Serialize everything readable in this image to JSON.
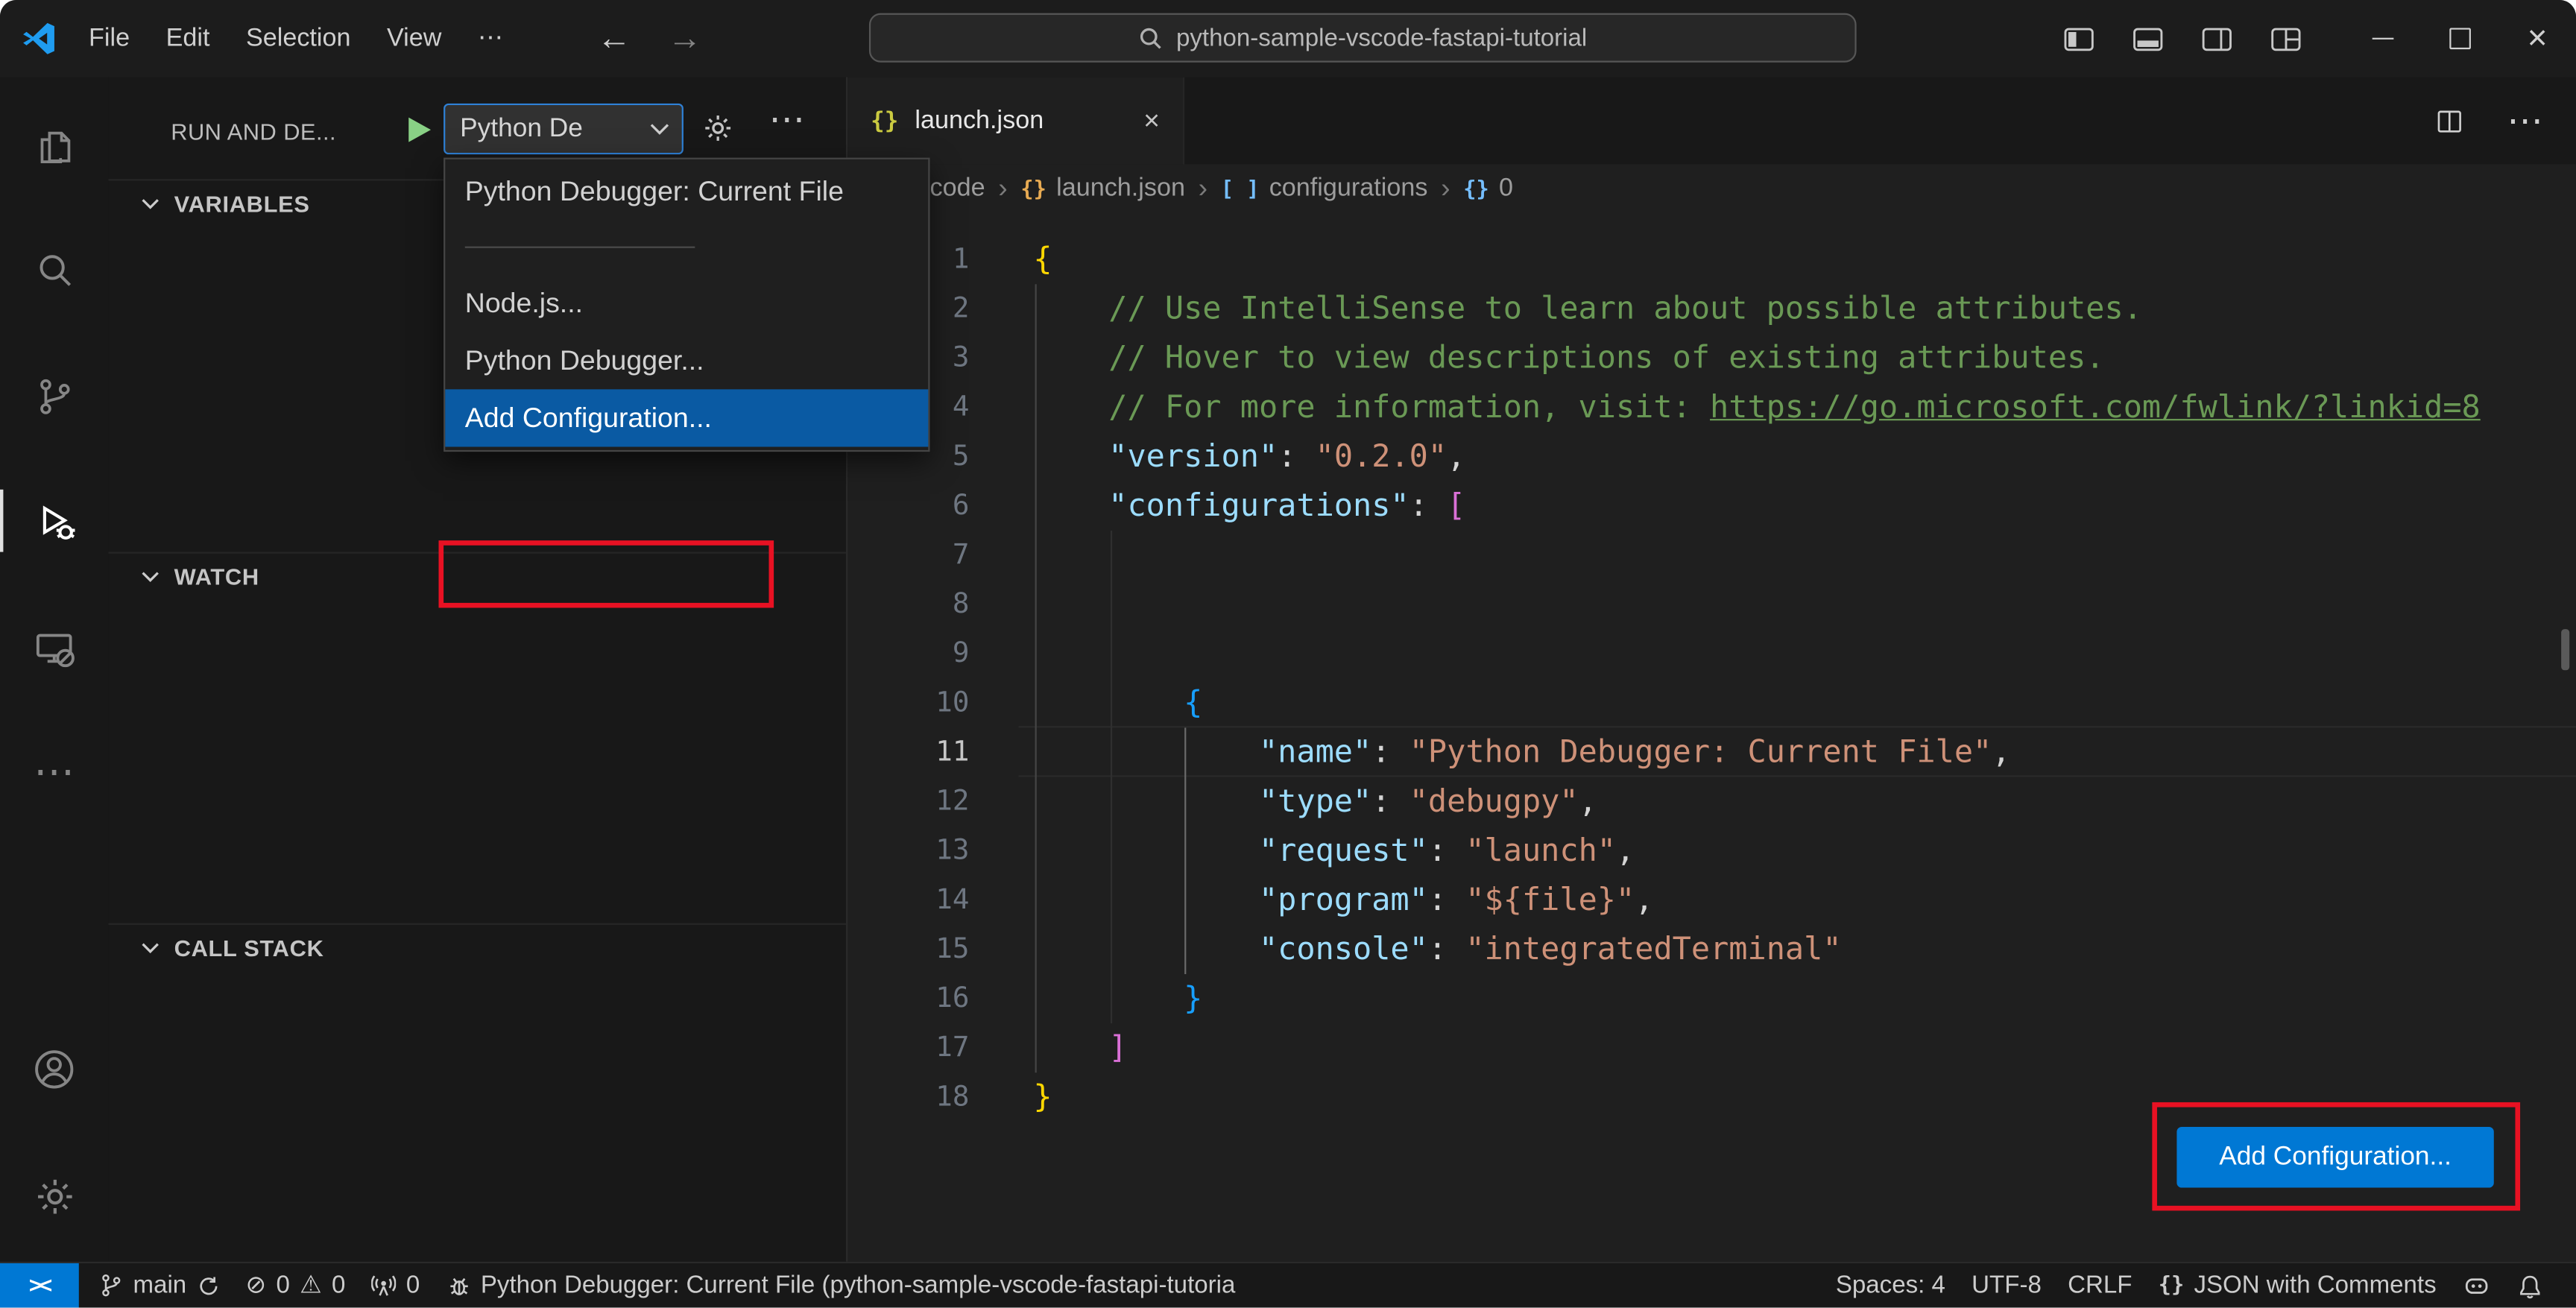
{
  "titlebar": {
    "menus": [
      "File",
      "Edit",
      "Selection",
      "View",
      "⋯"
    ],
    "search_text": "python-sample-vscode-fastapi-tutorial",
    "back_glyph": "←",
    "forward_glyph": "→",
    "close_glyph": "×"
  },
  "run_panel": {
    "title": "RUN AND DE...",
    "picker_value": "Python De",
    "sections": [
      "VARIABLES",
      "WATCH",
      "CALL STACK"
    ],
    "more_glyph": "⋯"
  },
  "config_menu": {
    "items": [
      "Python Debugger: Current File",
      "Node.js...",
      "Python Debugger...",
      "Add Configuration..."
    ],
    "selected_index": 3
  },
  "editor": {
    "tab_label": "launch.json",
    "tab_icon": "{}",
    "tab_close_glyph": "×",
    "tab_more_glyph": "⋯",
    "breadcrumbs": [
      {
        "label": "code",
        "icon": "",
        "color": ""
      },
      {
        "label": "launch.json",
        "icon": "{}",
        "color": "#e8ab53"
      },
      {
        "label": "configurations",
        "icon": "[ ]",
        "color": "#75beff"
      },
      {
        "label": "0",
        "icon": "{}",
        "color": "#75beff"
      }
    ],
    "add_config_button": "Add Configuration...",
    "current_line": 11,
    "code_lines": [
      [
        [
          "b1",
          "{"
        ]
      ],
      [
        [
          "ws",
          "    "
        ],
        [
          "cmt",
          "// Use IntelliSense to learn about possible attributes."
        ]
      ],
      [
        [
          "ws",
          "    "
        ],
        [
          "cmt",
          "// Hover to view descriptions of existing attributes."
        ]
      ],
      [
        [
          "ws",
          "    "
        ],
        [
          "cmt",
          "// For more information, visit: "
        ],
        [
          "lnk",
          "https://go.microsoft.com/fwlink/?linkid=8"
        ]
      ],
      [
        [
          "ws",
          "    "
        ],
        [
          "prop",
          "\"version\""
        ],
        [
          "pun",
          ": "
        ],
        [
          "str",
          "\"0.2.0\""
        ],
        [
          "pun",
          ","
        ]
      ],
      [
        [
          "ws",
          "    "
        ],
        [
          "prop",
          "\"configurations\""
        ],
        [
          "pun",
          ": "
        ],
        [
          "b2",
          "["
        ]
      ],
      [],
      [],
      [],
      [
        [
          "ws",
          "        "
        ],
        [
          "b3",
          "{"
        ]
      ],
      [
        [
          "ws",
          "            "
        ],
        [
          "prop",
          "\"name\""
        ],
        [
          "pun",
          ": "
        ],
        [
          "str",
          "\"Python Debugger: Current File\""
        ],
        [
          "pun",
          ","
        ]
      ],
      [
        [
          "ws",
          "            "
        ],
        [
          "prop",
          "\"type\""
        ],
        [
          "pun",
          ": "
        ],
        [
          "str",
          "\"debugpy\""
        ],
        [
          "pun",
          ","
        ]
      ],
      [
        [
          "ws",
          "            "
        ],
        [
          "prop",
          "\"request\""
        ],
        [
          "pun",
          ": "
        ],
        [
          "str",
          "\"launch\""
        ],
        [
          "pun",
          ","
        ]
      ],
      [
        [
          "ws",
          "            "
        ],
        [
          "prop",
          "\"program\""
        ],
        [
          "pun",
          ": "
        ],
        [
          "str",
          "\"${file}\""
        ],
        [
          "pun",
          ","
        ]
      ],
      [
        [
          "ws",
          "            "
        ],
        [
          "prop",
          "\"console\""
        ],
        [
          "pun",
          ": "
        ],
        [
          "str",
          "\"integratedTerminal\""
        ]
      ],
      [
        [
          "ws",
          "        "
        ],
        [
          "b3",
          "}"
        ]
      ],
      [
        [
          "ws",
          "    "
        ],
        [
          "b2",
          "]"
        ]
      ],
      [
        [
          "b1",
          "}"
        ]
      ]
    ]
  },
  "status_bar": {
    "remote_glyph": "><",
    "branch": "main",
    "errors": "0",
    "warnings": "0",
    "error_glyph": "⊘",
    "warning_glyph": "⚠",
    "ports": "0",
    "debug_status": "Python Debugger: Current File (python-sample-vscode-fastapi-tutoria",
    "spaces": "Spaces: 4",
    "encoding": "UTF-8",
    "eol": "CRLF",
    "language_icon": "{}",
    "language": "JSON with Comments"
  },
  "colors": {
    "accent": "#0078d4",
    "annotation_red": "#e81123",
    "menu_selection": "#0a5aa3",
    "comment": "#6a9955",
    "property": "#9cdcfe",
    "string": "#ce9178",
    "bracket_level1": "#ffd700",
    "bracket_level2": "#da70d6",
    "bracket_level3": "#179fff"
  }
}
